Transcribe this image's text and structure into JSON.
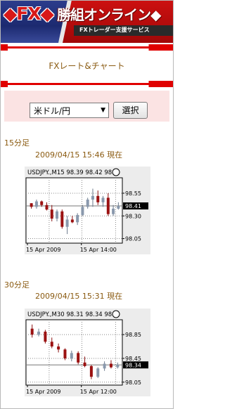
{
  "header": {
    "logo": "◆FX◆",
    "title": "勝組オンライン◆",
    "subtitle": "FXトレーダー支援サービス"
  },
  "page_title": "FXレート&チャート",
  "selector": {
    "selected": "米ドル/円",
    "button": "選択"
  },
  "charts": [
    {
      "period": "15分足",
      "timestamp": "2009/04/15 15:46 現在",
      "header_text": "USDJPY.,M15  98.39 98.42 98",
      "current_price": "98.41",
      "y_ticks": [
        "98.55",
        "98.30",
        "98.05"
      ],
      "x_ticks": [
        "15 Apr 2009",
        "15 Apr 14:00"
      ],
      "chart_data": {
        "type": "candlestick",
        "symbol": "USDJPY.",
        "timeframe": "M15",
        "ylim": [
          98.0,
          98.72
        ],
        "current": 98.41,
        "candles": [
          [
            98.44,
            98.44,
            98.38,
            98.4
          ],
          [
            98.4,
            98.48,
            98.38,
            98.46
          ],
          [
            98.46,
            98.47,
            98.4,
            98.42
          ],
          [
            98.42,
            98.45,
            98.36,
            98.37
          ],
          [
            98.37,
            98.42,
            98.24,
            98.27
          ],
          [
            98.27,
            98.37,
            98.24,
            98.35
          ],
          [
            98.35,
            98.37,
            98.16,
            98.18
          ],
          [
            98.18,
            98.3,
            98.1,
            98.26
          ],
          [
            98.26,
            98.3,
            98.22,
            98.23
          ],
          [
            98.23,
            98.33,
            98.2,
            98.31
          ],
          [
            98.31,
            98.42,
            98.3,
            98.4
          ],
          [
            98.4,
            98.5,
            98.38,
            98.48
          ],
          [
            98.48,
            98.6,
            98.4,
            98.52
          ],
          [
            98.52,
            98.58,
            98.42,
            98.45
          ],
          [
            98.45,
            98.52,
            98.4,
            98.5
          ],
          [
            98.5,
            98.55,
            98.3,
            98.32
          ],
          [
            98.32,
            98.42,
            98.3,
            98.38
          ],
          [
            98.38,
            98.45,
            98.37,
            98.41
          ]
        ]
      }
    },
    {
      "period": "30分足",
      "timestamp": "2009/04/15 15:31 現在",
      "header_text": "USDJPY.,M30  98.31 98.34 98",
      "current_price": "98.34",
      "y_ticks": [
        "98.85",
        "98.45",
        "98.05"
      ],
      "x_ticks": [
        "15 Apr 2009",
        "15 Apr 12:00"
      ],
      "chart_data": {
        "type": "candlestick",
        "symbol": "USDJPY.",
        "timeframe": "M30",
        "ylim": [
          98.0,
          99.1
        ],
        "current": 98.34,
        "candles": [
          [
            98.95,
            99.02,
            98.8,
            98.85
          ],
          [
            98.85,
            98.95,
            98.82,
            98.9
          ],
          [
            98.9,
            98.93,
            98.7,
            98.73
          ],
          [
            98.73,
            98.8,
            98.62,
            98.65
          ],
          [
            98.65,
            98.7,
            98.55,
            98.6
          ],
          [
            98.6,
            98.62,
            98.42,
            98.45
          ],
          [
            98.45,
            98.58,
            98.4,
            98.54
          ],
          [
            98.54,
            98.57,
            98.35,
            98.38
          ],
          [
            98.38,
            98.48,
            98.3,
            98.32
          ],
          [
            98.32,
            98.34,
            98.1,
            98.14
          ],
          [
            98.14,
            98.3,
            98.12,
            98.28
          ],
          [
            98.28,
            98.4,
            98.24,
            98.36
          ],
          [
            98.36,
            98.42,
            98.28,
            98.3
          ],
          [
            98.3,
            98.38,
            98.28,
            98.34
          ]
        ]
      }
    }
  ]
}
